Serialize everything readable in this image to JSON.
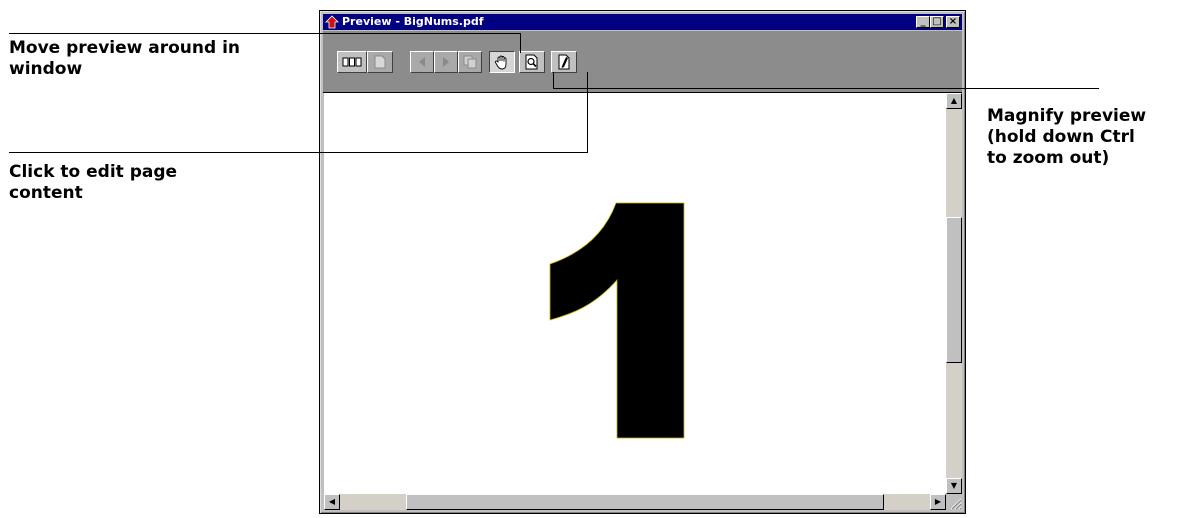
{
  "window": {
    "title": "Preview - BigNums.pdf",
    "caption_buttons": {
      "minimize": "_",
      "maximize": "□",
      "close": "×"
    }
  },
  "toolbar": {
    "buttons": [
      {
        "name": "thumbnails",
        "icon": "thumbnails-icon",
        "enabled": true
      },
      {
        "name": "single-page",
        "icon": "page-icon",
        "enabled": false
      },
      {
        "name": "previous-page",
        "icon": "triangle-left-icon",
        "enabled": false
      },
      {
        "name": "next-page",
        "icon": "triangle-right-icon",
        "enabled": false
      },
      {
        "name": "go-to-page",
        "icon": "pages-icon",
        "enabled": false
      },
      {
        "name": "hand-tool",
        "icon": "hand-icon",
        "enabled": true,
        "active": true
      },
      {
        "name": "magnify",
        "icon": "magnifier-page-icon",
        "enabled": true
      },
      {
        "name": "edit-page",
        "icon": "edit-page-icon",
        "enabled": true
      }
    ]
  },
  "document": {
    "page_content": "1"
  },
  "callouts": {
    "move_preview": "Move preview around in\nwindow",
    "edit_content": "Click to edit page\ncontent",
    "magnify": "Magnify preview\n(hold down Ctrl\nto zoom out)"
  },
  "scrollbars": {
    "up": "▲",
    "down": "▼",
    "left": "◀",
    "right": "▶"
  },
  "colors": {
    "titlebar": "#000080",
    "toolbar": "#8c8c8c",
    "window": "#c0c0c0",
    "glyph_fill": "#000000"
  }
}
